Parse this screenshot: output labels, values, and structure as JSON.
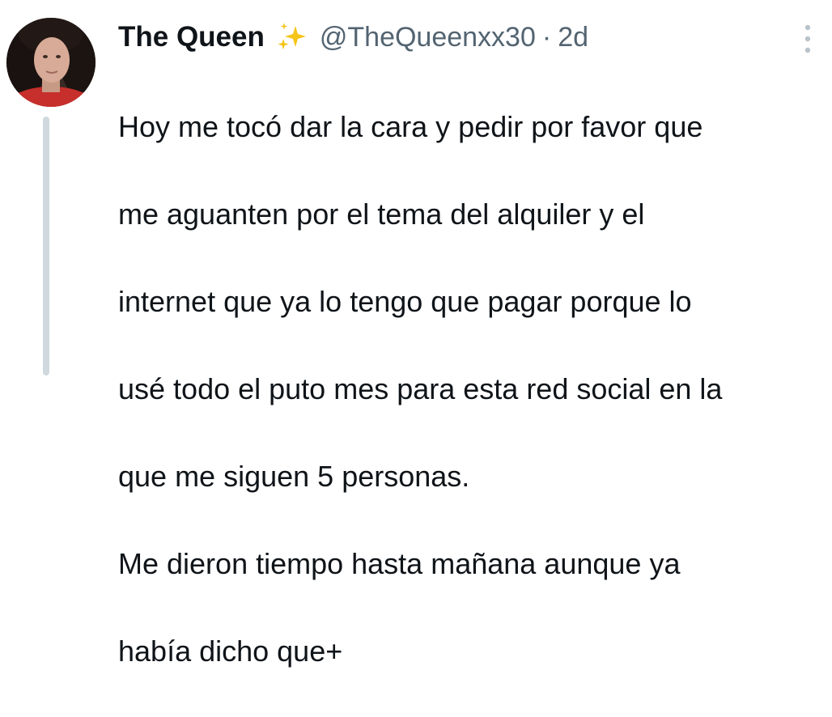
{
  "tweet": {
    "author": {
      "display_name": "The Queen",
      "emoji_icon": "sparkles-icon",
      "handle": "@TheQueenxx30",
      "separator": "·",
      "time_ago": "2d",
      "avatar_icon": "user-avatar"
    },
    "text_lines": [
      "Hoy me tocó dar la cara y pedir por favor que",
      "me aguanten por el tema del alquiler y el",
      "internet que ya lo tengo que pagar porque lo",
      "usé todo el puto mes para esta red social en la",
      "que me siguen 5 personas.",
      "Me dieron tiempo hasta mañana aunque ya",
      "había dicho que+"
    ],
    "more_icon": "more-vertical-icon"
  },
  "colors": {
    "text_primary": "#0f1419",
    "text_secondary": "#536471",
    "thread_line": "#cfd9de",
    "sparkles": "#f5c518"
  }
}
